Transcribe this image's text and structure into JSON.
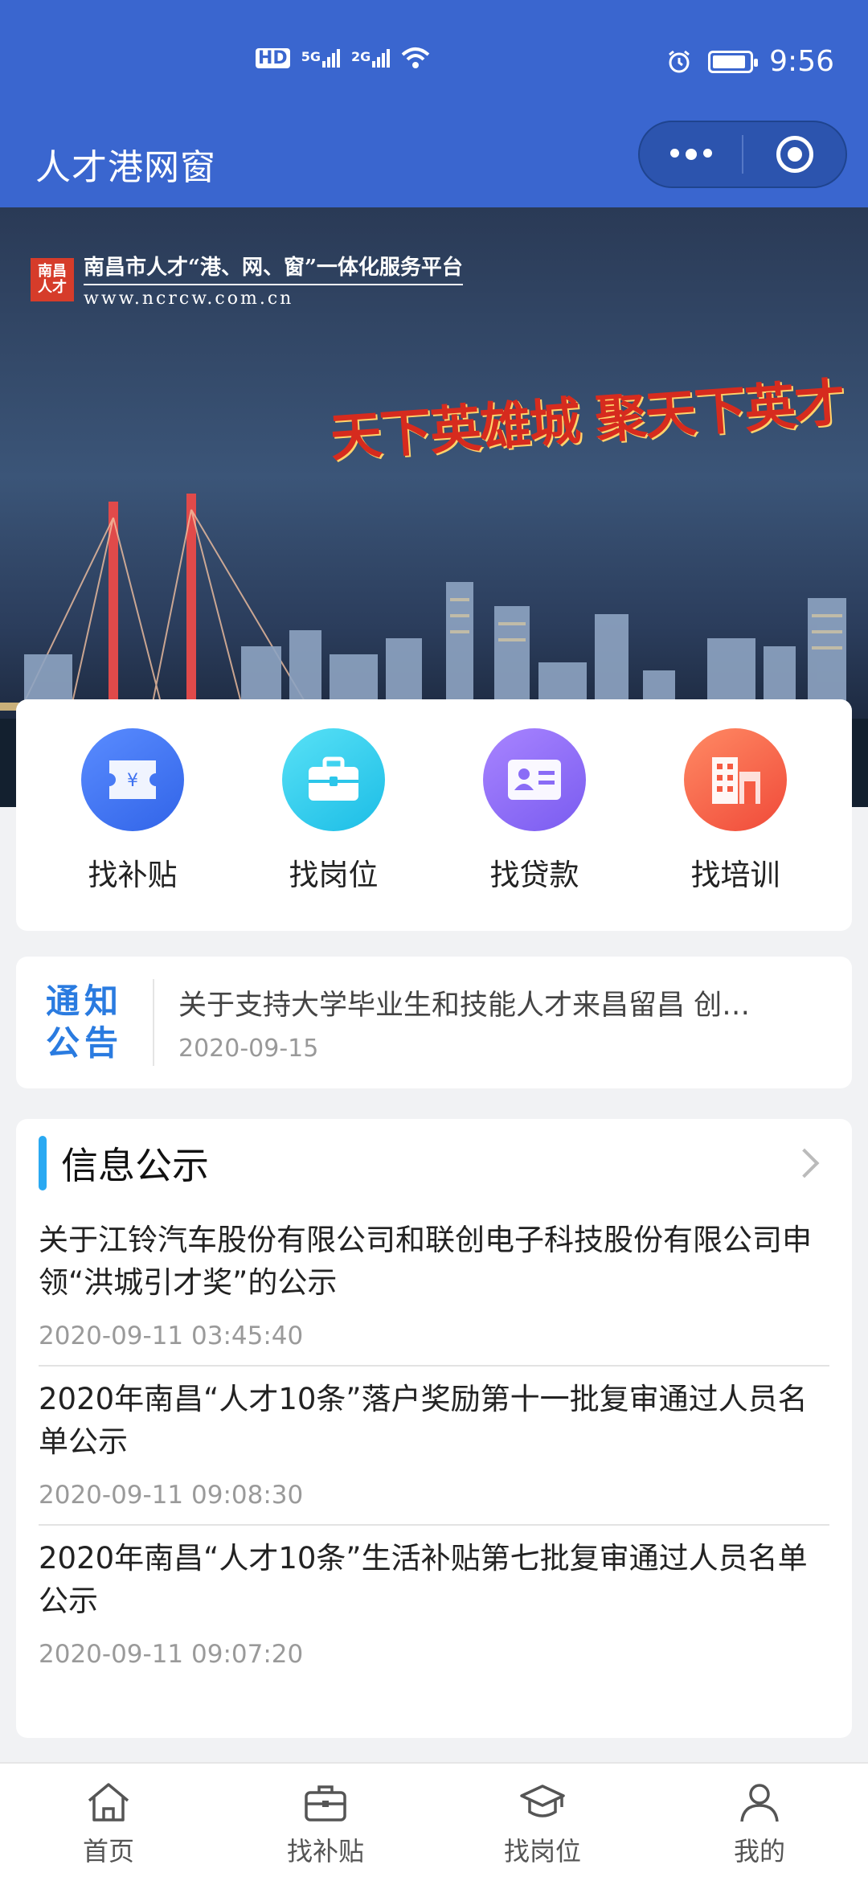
{
  "status_bar": {
    "network_labels": [
      "HD",
      "5G",
      "2G"
    ],
    "time": "9:56"
  },
  "nav": {
    "title": "人才港网窗"
  },
  "banner": {
    "seal_text": "南昌人才",
    "platform_name": "南昌市人才“港、网、窗”一体化服务平台",
    "url": "www.ncrcw.com.cn",
    "slogan": "天下英雄城 聚天下英才"
  },
  "quick_actions": [
    {
      "label": "找补贴",
      "icon": "subsidy-ticket-icon",
      "color": "#3f72f0"
    },
    {
      "label": "找岗位",
      "icon": "briefcase-icon",
      "color": "#2cc6ea"
    },
    {
      "label": "找贷款",
      "icon": "id-card-icon",
      "color": "#8a6cf6"
    },
    {
      "label": "找培训",
      "icon": "building-icon",
      "color": "#f55b42"
    }
  ],
  "notice": {
    "tag_line1": "通知",
    "tag_line2": "公告",
    "title": "关于支持大学毕业生和技能人才来昌留昌 创…",
    "date": "2020-09-15"
  },
  "info": {
    "section_title": "信息公示",
    "items": [
      {
        "title": "关于江铃汽车股份有限公司和联创电子科技股份有限公司申领“洪城引才奖”的公示",
        "time": "2020-09-11 03:45:40"
      },
      {
        "title": "2020年南昌“人才10条”落户奖励第十一批复审通过人员名单公示",
        "time": "2020-09-11 09:08:30"
      },
      {
        "title": "2020年南昌“人才10条”生活补贴第七批复审通过人员名单公示",
        "time": "2020-09-11 09:07:20"
      }
    ]
  },
  "tabbar": [
    {
      "label": "首页",
      "icon": "home-icon"
    },
    {
      "label": "找补贴",
      "icon": "briefcase-icon"
    },
    {
      "label": "找岗位",
      "icon": "graduation-cap-icon"
    },
    {
      "label": "我的",
      "icon": "user-icon"
    }
  ],
  "colors": {
    "primary": "#3a66cf",
    "accent_bar": "#2aa9f2",
    "notice_blue": "#2a7be0"
  }
}
